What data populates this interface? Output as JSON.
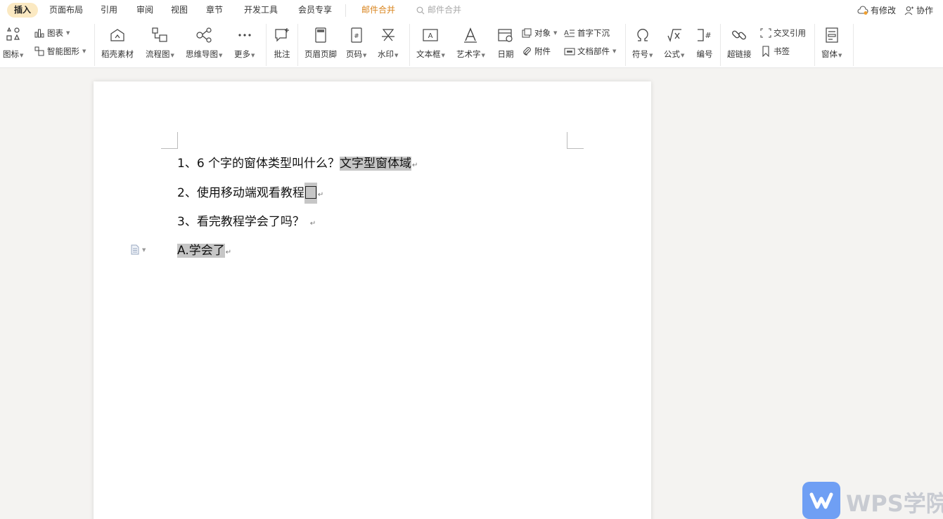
{
  "tabs": [
    {
      "label": "插入",
      "active": true
    },
    {
      "label": "页面布局"
    },
    {
      "label": "引用"
    },
    {
      "label": "审阅"
    },
    {
      "label": "视图"
    },
    {
      "label": "章节"
    },
    {
      "label": "开发工具"
    },
    {
      "label": "会员专享"
    },
    {
      "label": "邮件合并",
      "accent": true
    }
  ],
  "search": {
    "placeholder": "邮件合并"
  },
  "header_actions": {
    "modified": "有修改",
    "collaborate": "协作"
  },
  "ribbon": {
    "icons": "图标",
    "chart": "图表",
    "smart_shape": "智能图形",
    "daoke": "稻壳素材",
    "flowchart": "流程图",
    "mindmap": "思维导图",
    "more": "更多",
    "comment": "批注",
    "header_footer": "页眉页脚",
    "page_number": "页码",
    "watermark": "水印",
    "textbox": "文本框",
    "wordart": "艺术字",
    "date": "日期",
    "object": "对象",
    "attachment": "附件",
    "drop_cap": "首字下沉",
    "doc_parts": "文档部件",
    "symbol": "符号",
    "formula": "公式",
    "numbering": "编号",
    "hyperlink": "超链接",
    "cross_ref": "交叉引用",
    "bookmark": "书签",
    "form": "窗体"
  },
  "document": {
    "p1_question": "1、6 个字的窗体类型叫什么？",
    "p1_answer": "文字型窗体域",
    "p2_question": "2、使用移动端观看教程",
    "p3_question": "3、看完教程学会了吗？",
    "p4_answer": "A.学会了"
  },
  "watermark": {
    "text": "WPS学院"
  },
  "colors": {
    "accent": "#d9851f",
    "active_tab_bg": "#fbe9c2",
    "field_highlight": "#c6c6c6",
    "logo_blue": "#6f9ff4"
  }
}
